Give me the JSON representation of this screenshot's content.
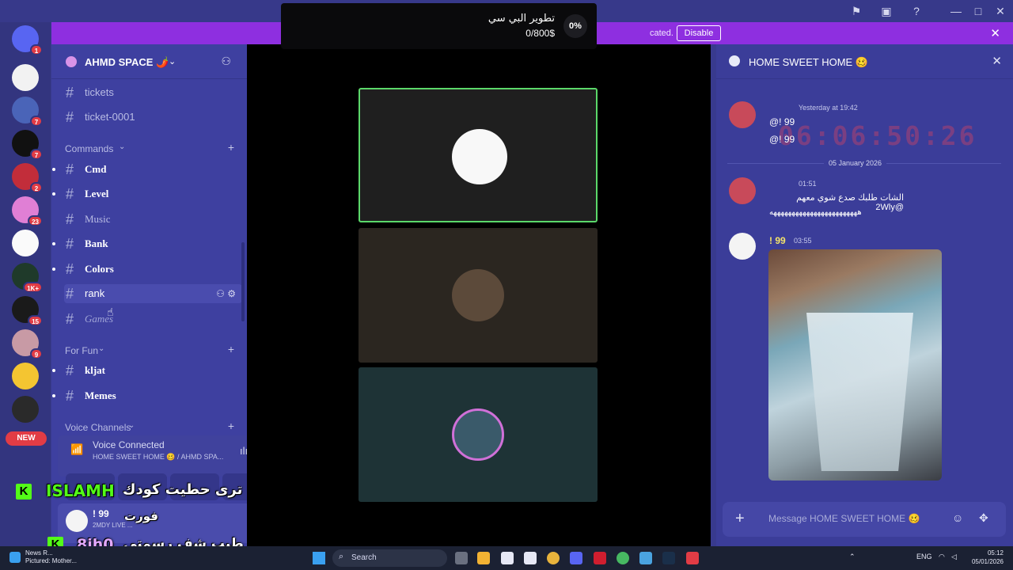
{
  "overlay": {
    "title": "تطوير البي سي",
    "amount": "0/800$",
    "percent": "0%"
  },
  "notice": {
    "text": "cated.",
    "disable_label": "Disable"
  },
  "rail": {
    "badges": [
      "1",
      "7",
      "7",
      "2",
      "23",
      "1K+",
      "15",
      "9"
    ],
    "new_label": "NEW"
  },
  "guild": {
    "name": "AHMD SPACE 🌶️"
  },
  "channels": {
    "top": [
      "tickets",
      "ticket-0001"
    ],
    "commands_label": "Commands",
    "commands": [
      "Cmd",
      "Level",
      "Music",
      "Bank",
      "Colors",
      "rank",
      "Games"
    ],
    "forfun_label": "For Fun",
    "forfun": [
      "kljat",
      "Memes"
    ],
    "voice_label": "Voice Channels"
  },
  "voice": {
    "title": "Voice Connected",
    "subtitle": "HOME SWEET HOME 🥴 / AHMD SPA..."
  },
  "stream_captions": {
    "line1_name": "ISLAMH",
    "line1_text": "ترى حطيت كودك",
    "line2_text": "فورت",
    "line3_name": "8jh0",
    "line3_text": "طيب شف رسمتي"
  },
  "user": {
    "name": "! 99",
    "status": "2MDY LIVE ..."
  },
  "chat": {
    "title": "HOME SWEET HOME 🥴",
    "timer": "06:06:50:26",
    "messages": [
      {
        "time": "Yesterday at 19:42",
        "lines": [
          "@! 99",
          "@! 99"
        ]
      },
      {
        "divider": "05 January 2026"
      },
      {
        "time": "01:51",
        "lines": [
          "الشات طلبك صدع شوي معهم @2Wly",
          "ههههههههههههههههههههههههه"
        ]
      },
      {
        "author": "! 99",
        "time": "03:55"
      }
    ],
    "placeholder": "Message HOME SWEET HOME 🥴"
  },
  "taskbar": {
    "news_title": "News R...",
    "news_sub": "Pictured: Mother...",
    "search_label": "Search",
    "lang": "ENG",
    "time": "05:12",
    "date": "05/01/2026"
  },
  "colors": {
    "accent": "#8e2fe0",
    "sidebar": "#3e40a0",
    "chat": "#3b3d99",
    "kick_green": "#53fc18"
  }
}
